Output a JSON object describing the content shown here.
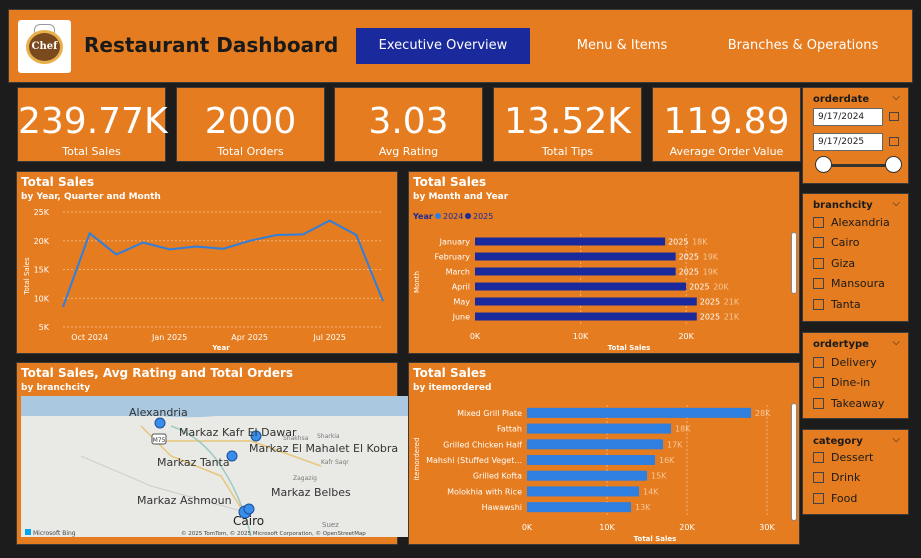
{
  "header": {
    "title": "Restaurant Dashboard",
    "logo_text": "Chef",
    "nav": [
      "Executive Overview",
      "Menu & Items",
      "Branches & Operations"
    ]
  },
  "kpis": [
    {
      "value": "239.77K",
      "label": "Total Sales"
    },
    {
      "value": "2000",
      "label": "Total Orders"
    },
    {
      "value": "3.03",
      "label": "Avg Rating"
    },
    {
      "value": "13.52K",
      "label": "Total Tips"
    },
    {
      "value": "119.89",
      "label": "Average Order Value"
    }
  ],
  "colors": {
    "orange": "#e57c1f",
    "nav_active": "#1a2a9c",
    "line": "#2f7fe0",
    "bar_2024": "#2f7fe0",
    "bar_2025": "#1a2a9c"
  },
  "line_chart": {
    "title": "Total Sales",
    "subtitle": "by Year, Quarter and Month",
    "ylabel": "Total Sales",
    "xlabel": "Year",
    "y_ticks": [
      "25K",
      "20K",
      "15K",
      "10K",
      "5K"
    ],
    "x_ticks": [
      "Oct 2024",
      "Jan 2025",
      "Apr 2025",
      "Jul 2025"
    ]
  },
  "month_chart": {
    "title": "Total Sales",
    "subtitle": "by Month and Year",
    "legend_title": "Year",
    "legend": [
      "2024",
      "2025"
    ],
    "ylabel": "Month",
    "xlabel": "Total Sales",
    "x_ticks": [
      "0K",
      "10K",
      "20K"
    ],
    "bar_year_label": "2025"
  },
  "map_panel": {
    "title": "Total Sales, Avg Rating and Total Orders",
    "subtitle": "by branchcity",
    "labels": [
      "Alexandria",
      "Markaz Kafr El Dawar",
      "Markaz El Mahalet El Kobra",
      "Markaz Tanta",
      "Markaz Ashmoun",
      "Markaz Belbes",
      "Cairo",
      "Shakhsa",
      "Kafr Saqr",
      "Zagazig",
      "Suez",
      "Sharkia"
    ],
    "road_label": "M75",
    "brand": "Microsoft Bing",
    "attribution": "© 2025 TomTom, © 2025 Microsoft Corporation, © OpenStreetMap"
  },
  "item_chart": {
    "title": "Total Sales",
    "subtitle": "by itemordered",
    "ylabel": "itemordered",
    "xlabel": "Total Sales",
    "x_ticks": [
      "0K",
      "10K",
      "20K",
      "30K"
    ]
  },
  "slicers": {
    "orderdate": {
      "title": "orderdate",
      "start": "9/17/2024",
      "end": "9/17/2025"
    },
    "branchcity": {
      "title": "branchcity",
      "items": [
        "Alexandria",
        "Cairo",
        "Giza",
        "Mansoura",
        "Tanta"
      ]
    },
    "ordertype": {
      "title": "ordertype",
      "items": [
        "Delivery",
        "Dine-in",
        "Takeaway"
      ]
    },
    "category": {
      "title": "category",
      "items": [
        "Dessert",
        "Drink",
        "Food"
      ]
    }
  },
  "chart_data": [
    {
      "type": "line",
      "title": "Total Sales",
      "subtitle": "by Year, Quarter and Month",
      "xlabel": "Year",
      "ylabel": "Total Sales",
      "x": [
        "Sep 2024",
        "Oct 2024",
        "Nov 2024",
        "Dec 2024",
        "Jan 2025",
        "Feb 2025",
        "Mar 2025",
        "Apr 2025",
        "May 2025",
        "Jun 2025",
        "Jul 2025",
        "Aug 2025",
        "Sep 2025"
      ],
      "values": [
        8500,
        21300,
        17600,
        19700,
        18500,
        19000,
        18600,
        20000,
        21000,
        21100,
        23500,
        21000,
        9500
      ],
      "ylim": [
        5000,
        25000
      ]
    },
    {
      "type": "bar",
      "title": "Total Sales",
      "subtitle": "by Month and Year",
      "orientation": "horizontal",
      "categories": [
        "January",
        "February",
        "March",
        "April",
        "May",
        "June"
      ],
      "series": [
        {
          "name": "2024",
          "values": [
            0,
            0,
            0,
            0,
            0,
            0
          ]
        },
        {
          "name": "2025",
          "values": [
            18000,
            19000,
            19000,
            20000,
            21000,
            21000
          ]
        }
      ],
      "data_labels": [
        "18K",
        "19K",
        "19K",
        "20K",
        "21K",
        "21K"
      ],
      "xlim": [
        0,
        25000
      ],
      "xlabel": "Total Sales",
      "ylabel": "Month"
    },
    {
      "type": "bar",
      "title": "Total Sales",
      "subtitle": "by itemordered",
      "orientation": "horizontal",
      "categories": [
        "Mixed Grill Plate",
        "Fattah",
        "Grilled Chicken Half",
        "Mahshi (Stuffed Veget...",
        "Grilled Kofta",
        "Molokhia with Rice",
        "Hawawshi"
      ],
      "values": [
        28000,
        18000,
        17000,
        16000,
        15000,
        14000,
        13000
      ],
      "data_labels": [
        "28K",
        "18K",
        "17K",
        "16K",
        "15K",
        "14K",
        "13K"
      ],
      "xlim": [
        0,
        30000
      ],
      "xlabel": "Total Sales",
      "ylabel": "itemordered"
    }
  ]
}
